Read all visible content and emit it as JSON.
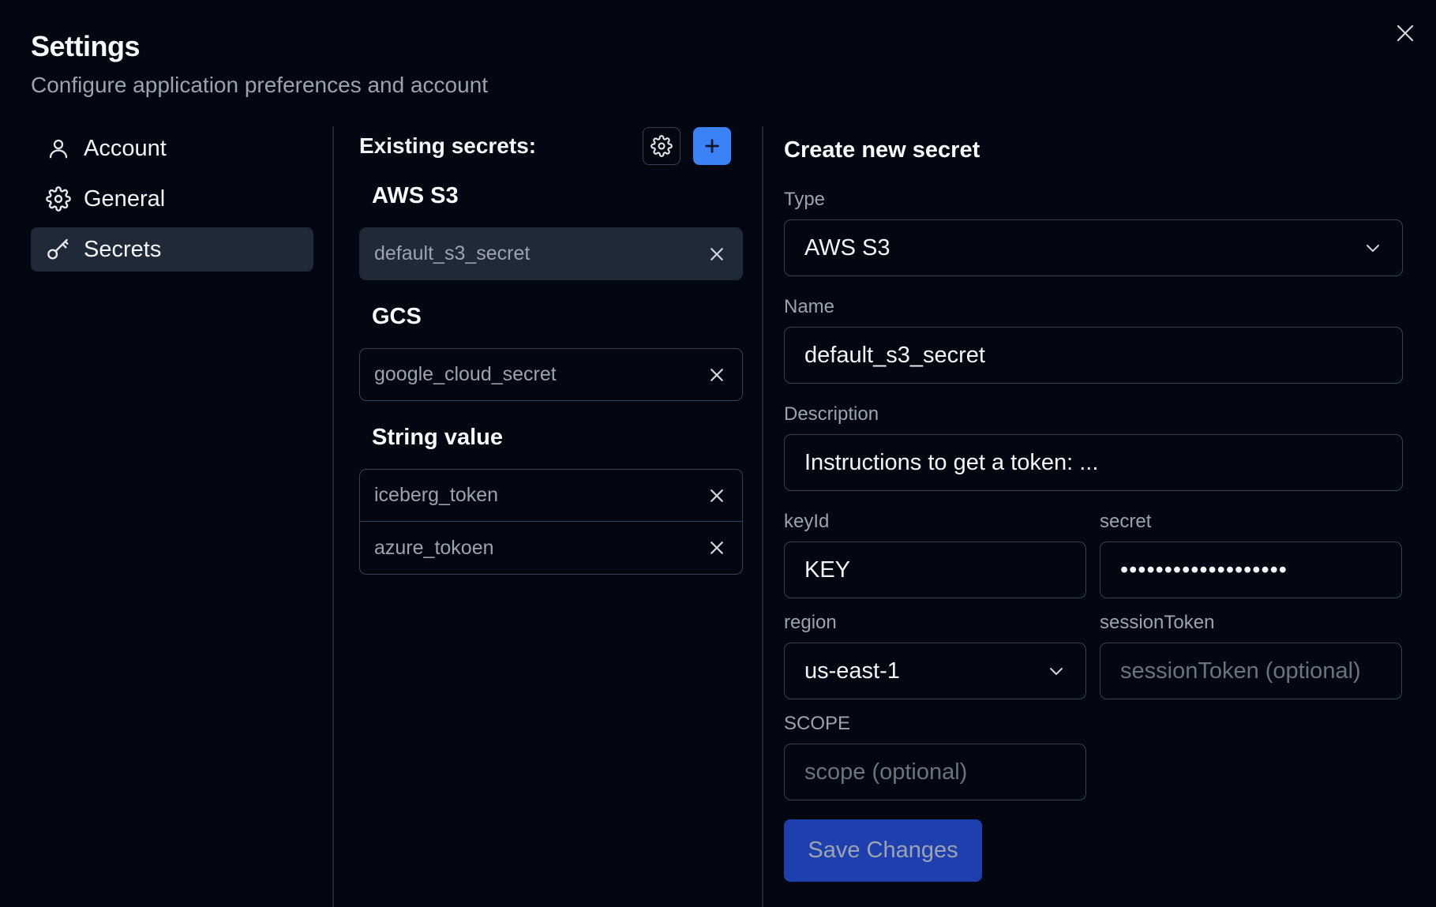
{
  "header": {
    "title": "Settings",
    "subtitle": "Configure application preferences and account"
  },
  "sidebar": {
    "items": [
      {
        "label": "Account",
        "icon": "user-icon",
        "active": false
      },
      {
        "label": "General",
        "icon": "gear-icon",
        "active": false
      },
      {
        "label": "Secrets",
        "icon": "key-icon",
        "active": true
      }
    ]
  },
  "secrets": {
    "title": "Existing secrets:",
    "groups": [
      {
        "title": "AWS S3",
        "items": [
          "default_s3_secret"
        ]
      },
      {
        "title": "GCS",
        "items": [
          "google_cloud_secret"
        ]
      },
      {
        "title": "String value",
        "items": [
          "iceberg_token",
          "azure_tokoen"
        ]
      }
    ]
  },
  "form": {
    "title": "Create new secret",
    "type_label": "Type",
    "type_value": "AWS S3",
    "name_label": "Name",
    "name_value": "default_s3_secret",
    "description_label": "Description",
    "description_value": "Instructions to get a token: ...",
    "keyid_label": "keyId",
    "keyid_value": "KEY",
    "secret_label": "secret",
    "secret_value": "•••••••••••••••••••",
    "region_label": "region",
    "region_value": "us-east-1",
    "session_label": "sessionToken",
    "session_placeholder": "sessionToken (optional)",
    "scope_label": "SCOPE",
    "scope_placeholder": "scope (optional)",
    "save_label": "Save Changes"
  },
  "colors": {
    "background": "#030712",
    "accent": "#3b82f6",
    "save_button": "#1e40af",
    "muted_text": "#9ca3af",
    "border": "#374151"
  }
}
